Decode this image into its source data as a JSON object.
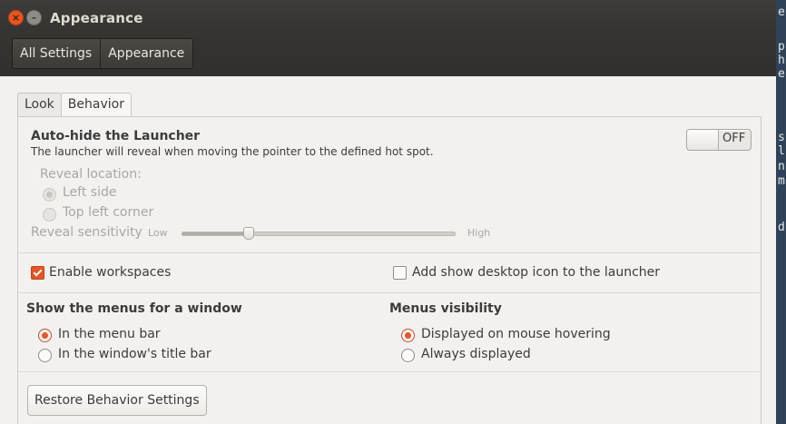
{
  "window": {
    "title": "Appearance",
    "close_glyph": "×",
    "minimize_glyph": "–"
  },
  "breadcrumbs": [
    "All Settings",
    "Appearance"
  ],
  "tabs": [
    {
      "label": "Look",
      "active": false
    },
    {
      "label": "Behavior",
      "active": true
    }
  ],
  "autohide": {
    "title": "Auto-hide the Launcher",
    "description": "The launcher will reveal when moving the pointer to the defined hot spot.",
    "toggle_state": "OFF",
    "reveal_location_label": "Reveal location:",
    "locations": [
      {
        "label": "Left side",
        "selected": true
      },
      {
        "label": "Top left corner",
        "selected": false
      }
    ],
    "sensitivity_label": "Reveal sensitivity",
    "sensitivity_low": "Low",
    "sensitivity_high": "High",
    "sensitivity_value": 0.24
  },
  "options": {
    "workspaces": {
      "label": "Enable workspaces",
      "checked": true
    },
    "desktop_icon": {
      "label": "Add show desktop icon to the launcher",
      "checked": false
    }
  },
  "menus": {
    "title": "Show the menus for a window",
    "choices": [
      {
        "label": "In the menu bar",
        "selected": true
      },
      {
        "label": "In the window's title bar",
        "selected": false
      }
    ]
  },
  "visibility": {
    "title": "Menus visibility",
    "choices": [
      {
        "label": "Displayed on mouse hovering",
        "selected": true
      },
      {
        "label": "Always displayed",
        "selected": false
      }
    ]
  },
  "restore_button": "Restore Behavior Settings",
  "background_terminal": {
    "lines": [
      "e",
      "p",
      "h",
      "e",
      "s",
      "l",
      "n",
      "m",
      "d"
    ]
  },
  "colors": {
    "accent": "#e95420",
    "titlebar": "#3c3b37",
    "window_bg": "#f2f1f0"
  }
}
